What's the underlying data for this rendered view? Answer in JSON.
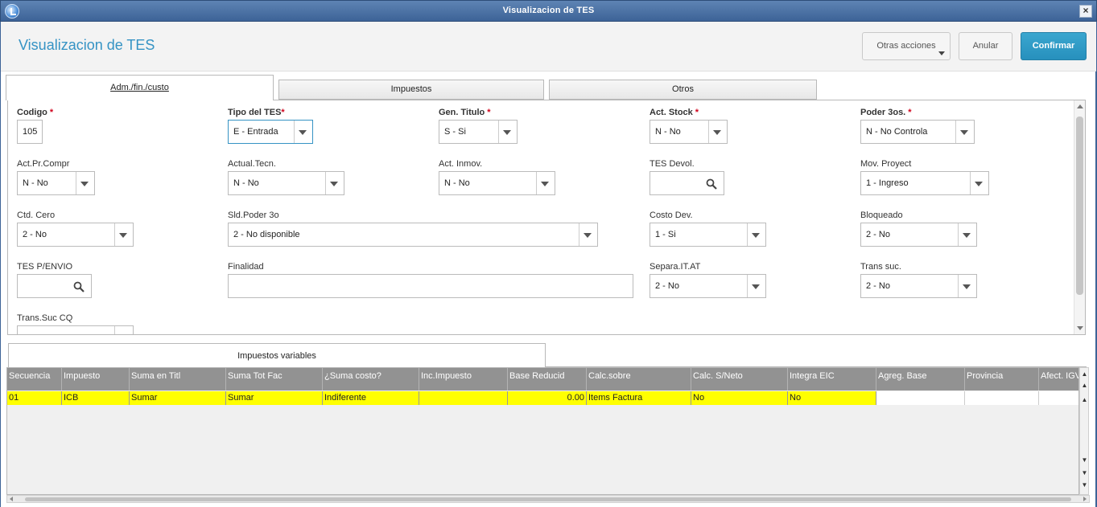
{
  "window": {
    "title": "Visualizacion de TES",
    "close": "×"
  },
  "header": {
    "title": "Visualizacion de TES"
  },
  "buttons": {
    "otras": "Otras acciones",
    "anular": "Anular",
    "confirmar": "Confirmar"
  },
  "tabs": [
    {
      "label": "Adm./fin./custo"
    },
    {
      "label": "Impuestos"
    },
    {
      "label": "Otros"
    }
  ],
  "form": {
    "codigo": {
      "label": "Codigo",
      "value": "105",
      "required": true
    },
    "tipo_tes": {
      "label": "Tipo del TES",
      "value": "E - Entrada",
      "required": true
    },
    "gen_titulo": {
      "label": "Gen. Titulo",
      "value": "S - Si",
      "required": true
    },
    "act_stock": {
      "label": "Act. Stock",
      "value": "N - No",
      "required": true
    },
    "poder_3os": {
      "label": "Poder 3os.",
      "value": "N - No Controla",
      "required": true
    },
    "act_pr_compr": {
      "label": "Act.Pr.Compr",
      "value": "N - No"
    },
    "actual_tecn": {
      "label": "Actual.Tecn.",
      "value": "N - No"
    },
    "act_inmov": {
      "label": "Act. Inmov.",
      "value": "N - No"
    },
    "tes_devol": {
      "label": "TES Devol.",
      "value": ""
    },
    "mov_proyect": {
      "label": "Mov. Proyect",
      "value": "1 - Ingreso"
    },
    "ctd_cero": {
      "label": "Ctd. Cero",
      "value": "2 - No"
    },
    "sld_poder": {
      "label": "Sld.Poder 3o",
      "value": "2 - No disponible"
    },
    "costo_dev": {
      "label": "Costo Dev.",
      "value": "1 - Si"
    },
    "bloqueado": {
      "label": "Bloqueado",
      "value": "2 - No"
    },
    "tes_penvio": {
      "label": "TES P/ENVIO",
      "value": ""
    },
    "finalidad": {
      "label": "Finalidad",
      "value": ""
    },
    "separa_itat": {
      "label": "Separa.IT.AT",
      "value": "2 - No"
    },
    "trans_suc": {
      "label": "Trans suc.",
      "value": "2 - No"
    },
    "trans_suc_cq": {
      "label": "Trans.Suc CQ",
      "value": ""
    }
  },
  "grid": {
    "tab_label": "Impuestos variables",
    "columns": [
      "Secuencia",
      "Impuesto",
      "Suma en Titl",
      "Suma Tot Fac",
      "¿Suma costo?",
      "Inc.Impuesto",
      "Base Reducid",
      "Calc.sobre",
      "Calc. S/Neto",
      "Integra EIC",
      "Agreg. Base",
      "Provincia",
      "Afect. IGV"
    ],
    "rows": [
      [
        "01",
        "ICB",
        "Sumar",
        "Sumar",
        "Indiferente",
        "",
        "0.00",
        "Items Factura",
        "No",
        "No",
        "",
        "",
        ""
      ]
    ]
  },
  "colors": {
    "accent": "#3593c4",
    "titlebar": "#3d6397",
    "required": "#d0021b",
    "row_highlight": "#ffff00",
    "grid_header": "#929292"
  },
  "icons": {
    "app": "app-logo-icon",
    "search": "search-icon",
    "dropdown": "chevron-down-icon"
  }
}
